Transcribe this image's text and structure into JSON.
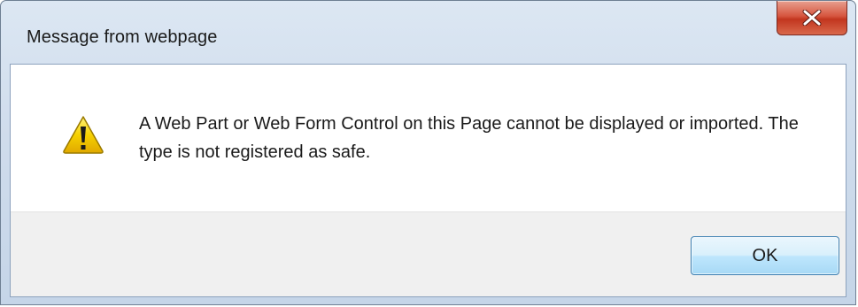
{
  "window": {
    "title": "Message from webpage",
    "close_icon": "close-icon"
  },
  "content": {
    "icon": "warning-icon",
    "message": "A Web Part or Web Form Control on this Page cannot be displayed or imported. The type is not registered as safe."
  },
  "buttons": {
    "ok_label": "OK"
  },
  "colors": {
    "close_button": "#c2361f",
    "ok_button_border": "#3c7fb1",
    "warning_yellow": "#f6d100"
  }
}
